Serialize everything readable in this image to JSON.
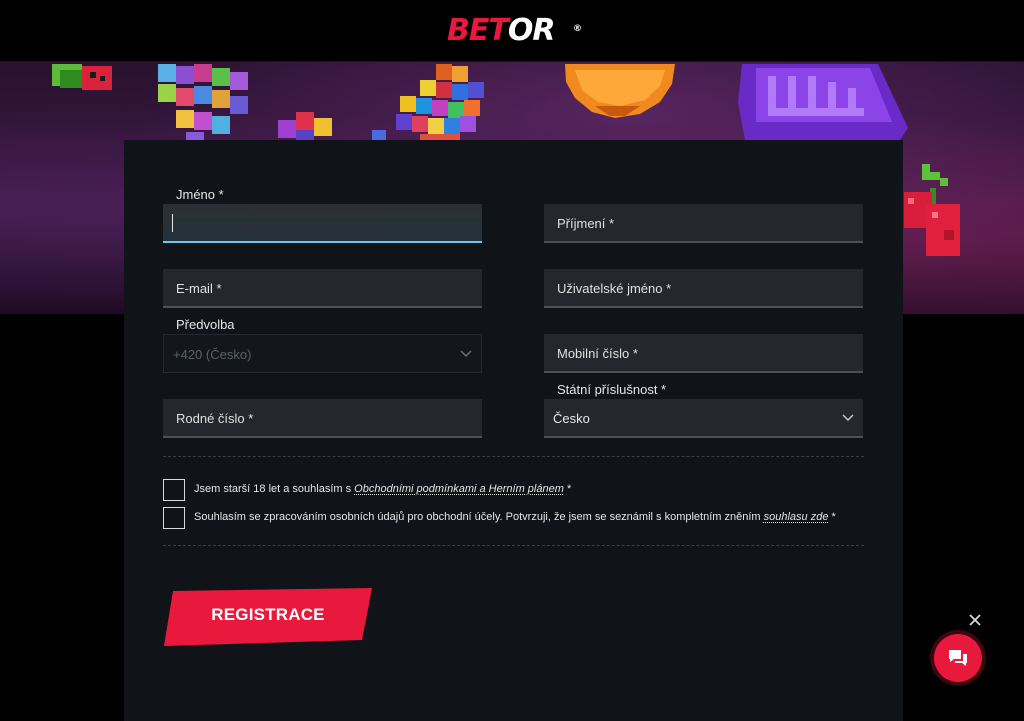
{
  "header": {
    "logo_bet": "BET",
    "logo_or": "OR",
    "logo_reg": "®"
  },
  "form": {
    "first_name_label": "Jméno *",
    "last_name_placeholder": "Příjmení *",
    "email_placeholder": "E-mail *",
    "username_placeholder": "Uživatelské jméno *",
    "prefix_label": "Předvolba",
    "prefix_value": "+420 (Česko)",
    "mobile_placeholder": "Mobilní číslo *",
    "nationality_label": "Státní příslušnost *",
    "nationality_value": "Česko",
    "birth_number_placeholder": "Rodné číslo *",
    "consent_terms_pre": "Jsem starší 18 let a souhlasím s ",
    "consent_terms_link": "Obchodními podmínkami a Herním plánem",
    "consent_terms_post": " *",
    "consent_gdpr_pre": "Souhlasím se zpracováním osobních údajů pro obchodní účely. Potvrzuji, že jsem se seznámil s kompletním zněním ",
    "consent_gdpr_link": "souhlasu zde",
    "consent_gdpr_post": " *",
    "register_button": "REGISTRACE"
  },
  "colors": {
    "brand_red": "#e8193c",
    "active_field_border": "#6fc7e3",
    "panel_bg": "#101418"
  },
  "icons": {
    "close": "close-icon",
    "chat": "chat-bubble-icon",
    "caret": "chevron-down-icon"
  }
}
